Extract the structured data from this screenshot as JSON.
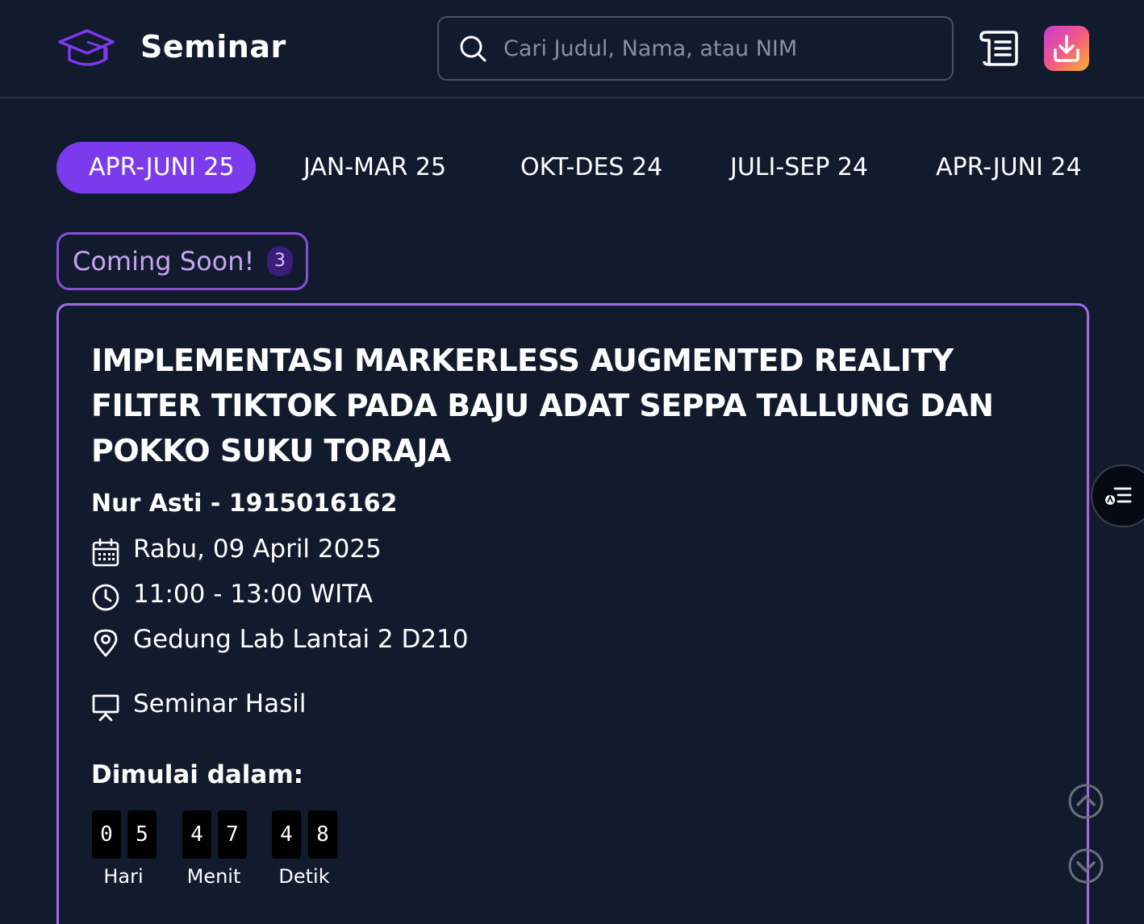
{
  "header": {
    "brand": "Seminar",
    "search_placeholder": "Cari Judul, Nama, atau NIM",
    "icons": [
      "graduation-cap-icon",
      "search-icon",
      "scroll-icon",
      "download-icon"
    ]
  },
  "tabs": [
    {
      "label": "APR-JUNI 25",
      "active": true
    },
    {
      "label": "JAN-MAR 25",
      "active": false
    },
    {
      "label": "OKT-DES 24",
      "active": false
    },
    {
      "label": "JULI-SEP 24",
      "active": false
    },
    {
      "label": "APR-JUNI 24",
      "active": false
    }
  ],
  "coming_soon": {
    "label": "Coming Soon!",
    "count": "3"
  },
  "seminar": {
    "title": "IMPLEMENTASI MARKERLESS AUGMENTED REALITY FILTER TIKTOK PADA BAJU ADAT SEPPA TALLUNG DAN POKKO SUKU TORAJA",
    "presenter": "Nur Asti - 1915016162",
    "date": "Rabu, 09 April 2025",
    "time": "11:00 - 13:00 WITA",
    "location": "Gedung Lab Lantai 2 D210",
    "type": "Seminar Hasil",
    "countdown": {
      "label": "Dimulai dalam:",
      "days": [
        "0",
        "5"
      ],
      "minutes": [
        "4",
        "7"
      ],
      "seconds": [
        "4",
        "8"
      ],
      "days_label": "Hari",
      "minutes_label": "Menit",
      "seconds_label": "Detik"
    }
  },
  "colors": {
    "background": "#121a2e",
    "accent": "#7c3aed",
    "card_border": "#a36ce0"
  }
}
